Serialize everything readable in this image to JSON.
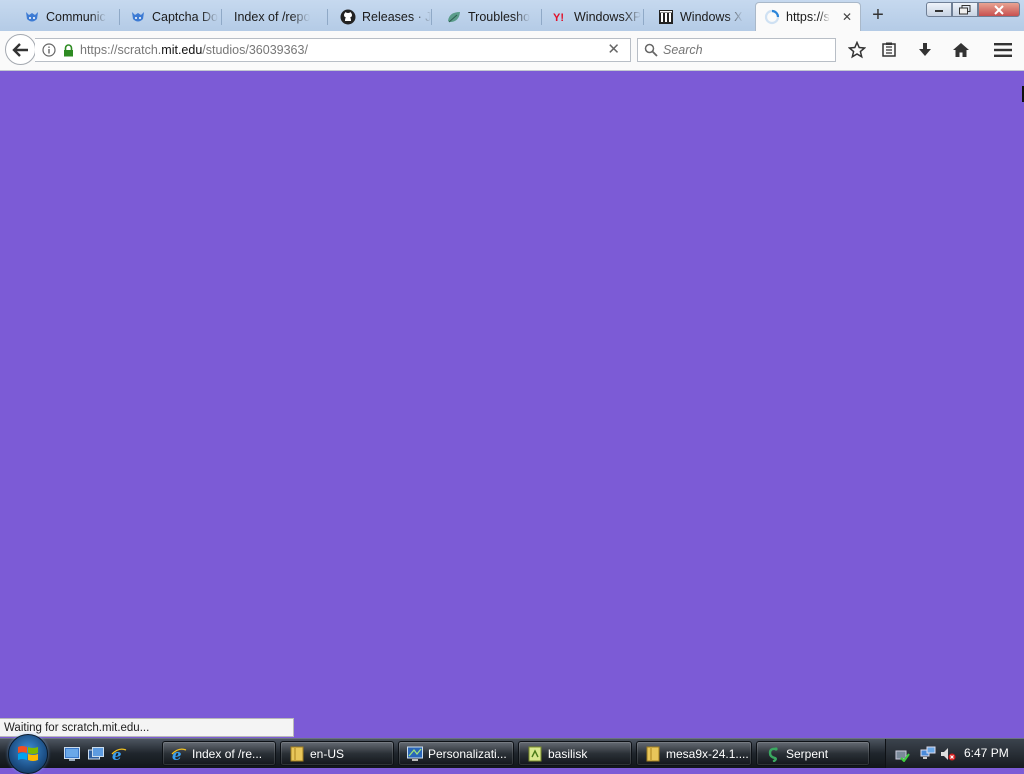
{
  "browser": {
    "tabs": [
      {
        "label": "Communic",
        "icon": "scratch-cat-icon"
      },
      {
        "label": "Captcha Do",
        "icon": "scratch-cat-icon"
      },
      {
        "label": "Index of /repo",
        "icon": "none"
      },
      {
        "label": "Releases · J",
        "icon": "github-icon"
      },
      {
        "label": "Troublesho",
        "icon": "leaf-icon"
      },
      {
        "label": "WindowsXP",
        "icon": "yahoo-icon"
      },
      {
        "label": "Windows X",
        "icon": "archive-icon"
      },
      {
        "label": "https://s",
        "icon": "loading-spinner-icon",
        "active": true
      }
    ],
    "url": {
      "prefix": "https://scratch.",
      "host": "mit.edu",
      "path": "/studios/36039363/"
    },
    "search_placeholder": "Search",
    "status_text": "Waiting for scratch.mit.edu..."
  },
  "taskbar": {
    "buttons": [
      {
        "label": "Index of /re...",
        "icon": "ie-icon"
      },
      {
        "label": "en-US",
        "icon": "folder-icon"
      },
      {
        "label": "Personalizati...",
        "icon": "monitor-icon"
      },
      {
        "label": "basilisk",
        "icon": "file-icon"
      },
      {
        "label": "mesa9x-24.1....",
        "icon": "folder-icon"
      },
      {
        "label": "Serpent",
        "icon": "serpent-icon"
      }
    ],
    "clock": "6:47 PM"
  },
  "colors": {
    "page_background": "#7c5bd6",
    "taskbar": "#1f252c"
  }
}
